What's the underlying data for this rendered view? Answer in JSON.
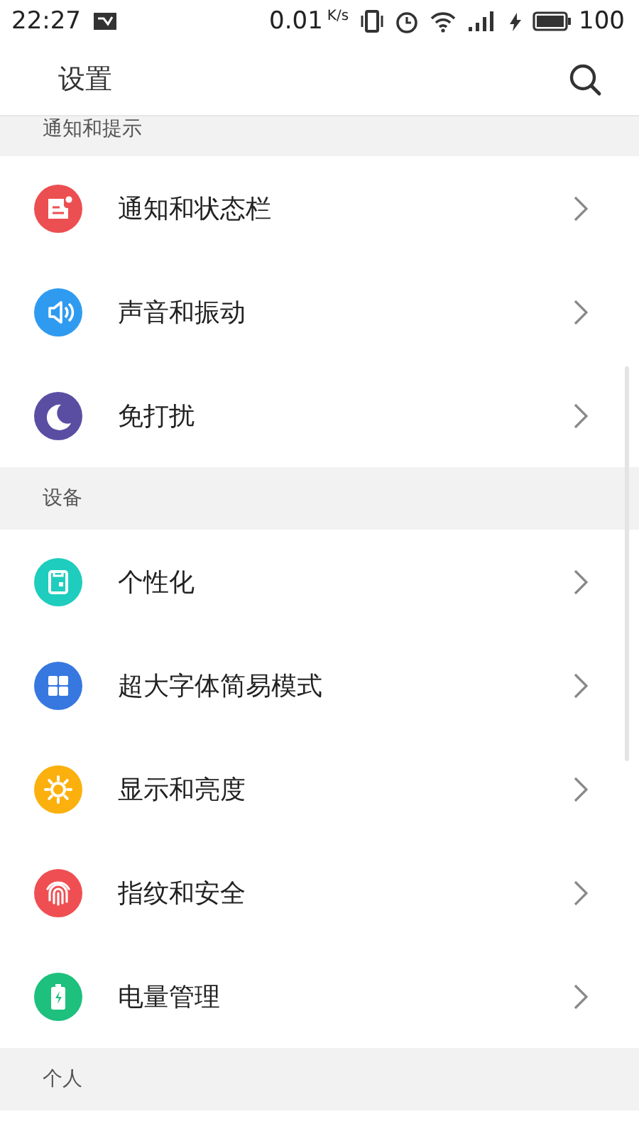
{
  "status_bar": {
    "time": "22:27",
    "speed": "0.01",
    "speed_unit": "K/s",
    "battery": "100"
  },
  "header": {
    "title": "设置"
  },
  "sections": [
    {
      "title": "通知和提示",
      "items": [
        {
          "label": "通知和状态栏",
          "kind": "notice",
          "color": "#ec4f51"
        },
        {
          "label": "声音和振动",
          "kind": "sound",
          "color": "#2f9bf0"
        },
        {
          "label": "免打扰",
          "kind": "moon",
          "color": "#5a4ea3"
        }
      ]
    },
    {
      "title": "设备",
      "items": [
        {
          "label": "个性化",
          "kind": "theme",
          "color": "#1ecdbd"
        },
        {
          "label": "超大字体简易模式",
          "kind": "grid",
          "color": "#3778e0"
        },
        {
          "label": "显示和亮度",
          "kind": "sun",
          "color": "#fbb00e"
        },
        {
          "label": "指纹和安全",
          "kind": "fingerprint",
          "color": "#ef4f52"
        },
        {
          "label": "电量管理",
          "kind": "battery",
          "color": "#1dc07d"
        }
      ]
    },
    {
      "title": "个人"
    }
  ]
}
